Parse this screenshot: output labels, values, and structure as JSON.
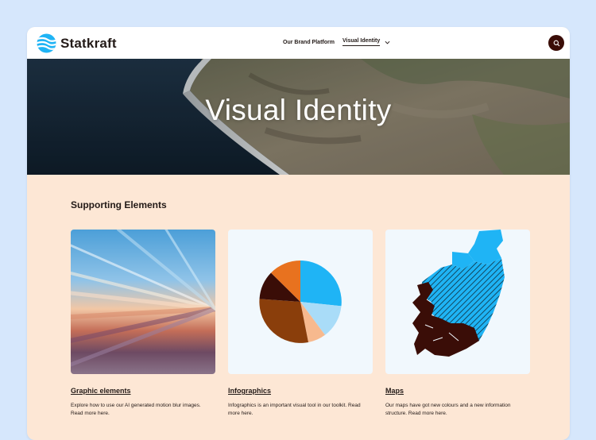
{
  "brand": {
    "name": "Statkraft"
  },
  "nav": {
    "items": [
      {
        "label": "Our Brand Platform"
      },
      {
        "label": "Visual Identity"
      }
    ]
  },
  "hero": {
    "title": "Visual Identity"
  },
  "section": {
    "title": "Supporting Elements"
  },
  "cards": [
    {
      "title": "Graphic elements",
      "description": "Explore how to use our AI generated motion blur images. Read more here."
    },
    {
      "title": "Infographics",
      "description": "Infographics is an important visual tool in our toolkit. Read more here."
    },
    {
      "title": "Maps",
      "description": "Our maps have got new colours and a new information structure. Read more here."
    }
  ],
  "icons": [
    "statkraft-logo-icon",
    "chevron-down-icon",
    "search-icon"
  ],
  "colors": {
    "page_bg": "#d6e7fc",
    "content_bg": "#fde7d5",
    "text": "#231a17",
    "accent_blue": "#1fb4f5",
    "accent_orange": "#e8721f",
    "dark_brown": "#3a0d07"
  }
}
